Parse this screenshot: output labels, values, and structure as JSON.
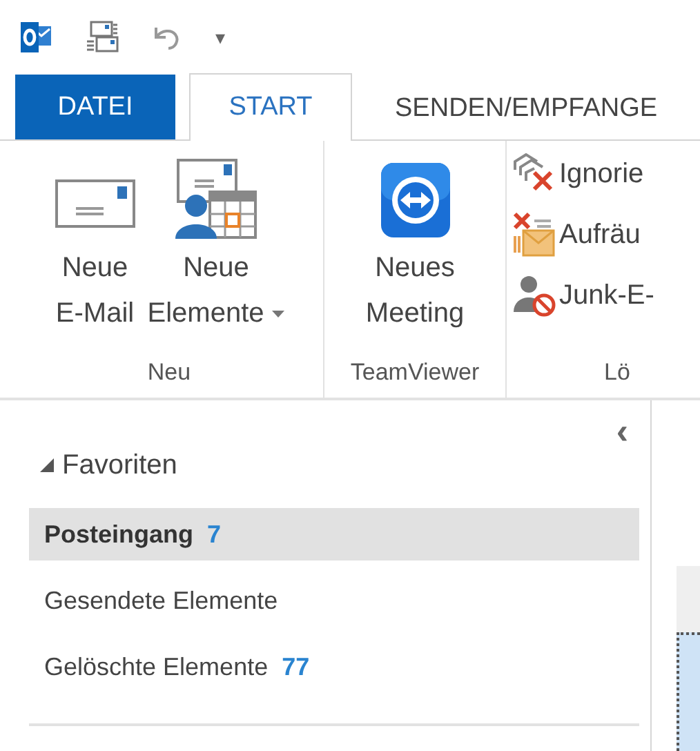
{
  "quick_access": {
    "customize": "▾"
  },
  "tabs": [
    {
      "label": "DATEI",
      "kind": "file"
    },
    {
      "label": "START",
      "kind": "tab",
      "selected": true
    },
    {
      "label": "SENDEN/EMPFANGE",
      "kind": "tab",
      "selected": false
    }
  ],
  "ribbon": {
    "groups": [
      {
        "label": "Neu",
        "buttons": [
          {
            "kind": "large",
            "lines": [
              "Neue",
              "E-Mail"
            ],
            "dropdown": false
          },
          {
            "kind": "large",
            "lines": [
              "Neue",
              "Elemente"
            ],
            "dropdown": true
          }
        ]
      },
      {
        "label": "TeamViewer",
        "buttons": [
          {
            "kind": "large",
            "lines": [
              "Neues",
              "Meeting"
            ],
            "dropdown": false
          }
        ]
      },
      {
        "label": "Lö",
        "buttons": [
          {
            "kind": "small",
            "lines": [
              "Ignorie"
            ]
          },
          {
            "kind": "small",
            "lines": [
              "Aufräu"
            ]
          },
          {
            "kind": "small",
            "lines": [
              "Junk-E-"
            ]
          }
        ]
      }
    ]
  },
  "navigation": {
    "collapse": "‹",
    "section": {
      "label": "Favoriten",
      "expanded": true,
      "items": [
        {
          "label": "Posteingang",
          "count": "7",
          "selected": true
        },
        {
          "label": "Gesendete Elemente",
          "selected": false
        },
        {
          "label": "Gelöschte Elemente",
          "count": "77",
          "selected": false
        }
      ]
    }
  }
}
